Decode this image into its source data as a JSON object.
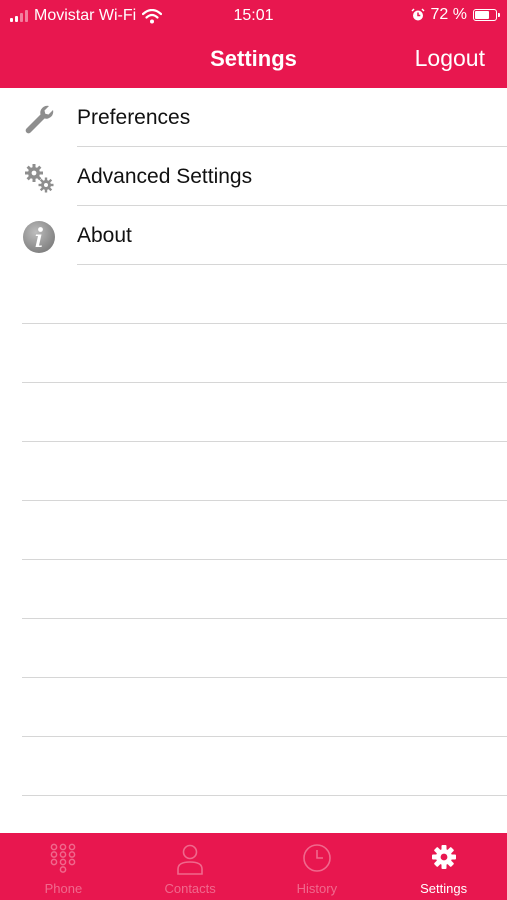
{
  "status_bar": {
    "carrier": "Movistar Wi-Fi",
    "time": "15:01",
    "battery_percent": "72 %",
    "battery_level": 0.72
  },
  "nav": {
    "title": "Settings",
    "logout_label": "Logout"
  },
  "menu": [
    {
      "label": "Preferences",
      "icon": "wrench-icon"
    },
    {
      "label": "Advanced Settings",
      "icon": "gears-icon"
    },
    {
      "label": "About",
      "icon": "info-icon"
    }
  ],
  "tabs": [
    {
      "label": "Phone",
      "icon": "keypad-icon",
      "active": false
    },
    {
      "label": "Contacts",
      "icon": "person-icon",
      "active": false
    },
    {
      "label": "History",
      "icon": "clock-icon",
      "active": false
    },
    {
      "label": "Settings",
      "icon": "gear-icon",
      "active": true
    }
  ],
  "colors": {
    "brand": "#e8174f",
    "separator": "#d6d6d6",
    "icon_gray": "#8e8e8e"
  }
}
